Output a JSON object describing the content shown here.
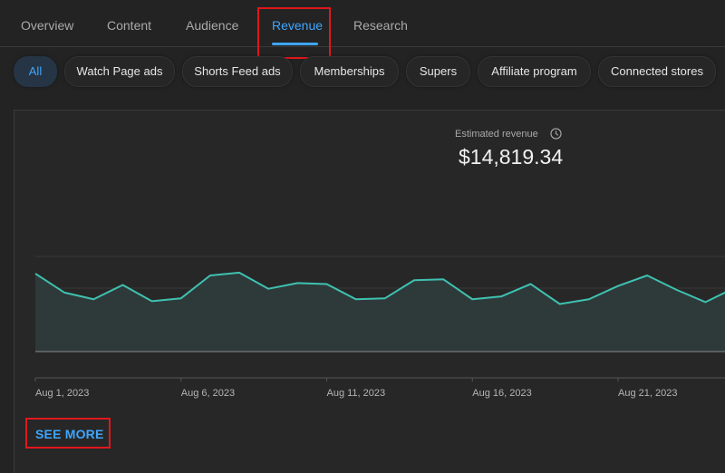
{
  "tabs": [
    {
      "label": "Overview",
      "active": false
    },
    {
      "label": "Content",
      "active": false
    },
    {
      "label": "Audience",
      "active": false
    },
    {
      "label": "Revenue",
      "active": true
    },
    {
      "label": "Research",
      "active": false
    }
  ],
  "chips": [
    {
      "label": "All",
      "active": true
    },
    {
      "label": "Watch Page ads",
      "active": false
    },
    {
      "label": "Shorts Feed ads",
      "active": false
    },
    {
      "label": "Memberships",
      "active": false
    },
    {
      "label": "Supers",
      "active": false
    },
    {
      "label": "Affiliate program",
      "active": false
    },
    {
      "label": "Connected stores",
      "active": false
    }
  ],
  "metric": {
    "label": "Estimated revenue",
    "icon": "clock-icon",
    "value": "$14,819.34"
  },
  "see_more_label": "SEE MORE",
  "colors": {
    "accent": "#3ea6ff",
    "line": "#3fc1b0",
    "area_fill": "#2e3a3a",
    "highlight": "#e0171c"
  },
  "chart_data": {
    "type": "area",
    "title": "Estimated revenue",
    "x": [
      "Aug 1, 2023",
      "Aug 2, 2023",
      "Aug 3, 2023",
      "Aug 4, 2023",
      "Aug 5, 2023",
      "Aug 6, 2023",
      "Aug 7, 2023",
      "Aug 8, 2023",
      "Aug 9, 2023",
      "Aug 10, 2023",
      "Aug 11, 2023",
      "Aug 12, 2023",
      "Aug 13, 2023",
      "Aug 14, 2023",
      "Aug 15, 2023",
      "Aug 16, 2023",
      "Aug 17, 2023",
      "Aug 18, 2023",
      "Aug 19, 2023",
      "Aug 20, 2023",
      "Aug 21, 2023",
      "Aug 22, 2023",
      "Aug 23, 2023",
      "Aug 24, 2023",
      "Aug 25, 2023"
    ],
    "series": [
      {
        "name": "Estimated revenue",
        "values": [
          0.82,
          0.62,
          0.55,
          0.7,
          0.53,
          0.56,
          0.8,
          0.83,
          0.66,
          0.72,
          0.71,
          0.55,
          0.56,
          0.75,
          0.76,
          0.55,
          0.58,
          0.71,
          0.5,
          0.55,
          0.69,
          0.8,
          0.65,
          0.52,
          0.67
        ]
      }
    ],
    "value_units": "relative (gridline = 1.0, unlabeled axis)",
    "ylim": [
      0,
      1.0
    ],
    "x_tick_labels": [
      "Aug 1, 2023",
      "Aug 6, 2023",
      "Aug 11, 2023",
      "Aug 16, 2023",
      "Aug 21, 2023"
    ],
    "xlabel": "",
    "ylabel": "",
    "grid": true,
    "legend": "none"
  }
}
